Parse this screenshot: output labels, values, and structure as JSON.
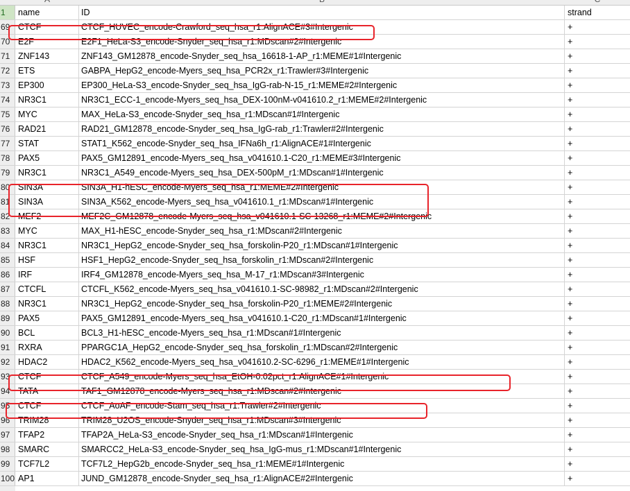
{
  "columns": {
    "row_header_label": "1",
    "letters": [
      "A",
      "B",
      "C"
    ],
    "headers": [
      "name",
      "ID",
      "strand"
    ]
  },
  "rows": [
    {
      "num": "69",
      "name": "CTCF",
      "id": "CTCF_HUVEC_encode-Crawford_seq_hsa_r1:AlignACE#3#Intergenic",
      "strand": "+"
    },
    {
      "num": "70",
      "name": "E2F",
      "id": "E2F1_HeLa-S3_encode-Snyder_seq_hsa_r1:MDscan#2#Intergenic",
      "strand": "+"
    },
    {
      "num": "71",
      "name": "ZNF143",
      "id": "ZNF143_GM12878_encode-Snyder_seq_hsa_16618-1-AP_r1:MEME#1#Intergenic",
      "strand": "+"
    },
    {
      "num": "72",
      "name": "ETS",
      "id": "GABPA_HepG2_encode-Myers_seq_hsa_PCR2x_r1:Trawler#3#Intergenic",
      "strand": "+"
    },
    {
      "num": "73",
      "name": "EP300",
      "id": "EP300_HeLa-S3_encode-Snyder_seq_hsa_IgG-rab-N-15_r1:MEME#2#Intergenic",
      "strand": "+"
    },
    {
      "num": "74",
      "name": "NR3C1",
      "id": "NR3C1_ECC-1_encode-Myers_seq_hsa_DEX-100nM-v041610.2_r1:MEME#2#Intergenic",
      "strand": "+"
    },
    {
      "num": "75",
      "name": "MYC",
      "id": "MAX_HeLa-S3_encode-Snyder_seq_hsa_r1:MDscan#1#Intergenic",
      "strand": "+"
    },
    {
      "num": "76",
      "name": "RAD21",
      "id": "RAD21_GM12878_encode-Snyder_seq_hsa_IgG-rab_r1:Trawler#2#Intergenic",
      "strand": "+"
    },
    {
      "num": "77",
      "name": "STAT",
      "id": "STAT1_K562_encode-Snyder_seq_hsa_IFNa6h_r1:AlignACE#1#Intergenic",
      "strand": "+"
    },
    {
      "num": "78",
      "name": "PAX5",
      "id": "PAX5_GM12891_encode-Myers_seq_hsa_v041610.1-C20_r1:MEME#3#Intergenic",
      "strand": "+"
    },
    {
      "num": "79",
      "name": "NR3C1",
      "id": "NR3C1_A549_encode-Myers_seq_hsa_DEX-500pM_r1:MDscan#1#Intergenic",
      "strand": "+"
    },
    {
      "num": "80",
      "name": "SIN3A",
      "id": "SIN3A_H1-hESC_encode-Myers_seq_hsa_r1:MEME#2#Intergenic",
      "strand": "+"
    },
    {
      "num": "81",
      "name": "SIN3A",
      "id": "SIN3A_K562_encode-Myers_seq_hsa_v041610.1_r1:MDscan#1#Intergenic",
      "strand": "+"
    },
    {
      "num": "82",
      "name": "MEF2",
      "id": "MEF2C_GM12878_encode-Myers_seq_hsa_v041610.1-SC-13268_r1:MEME#2#Intergenic",
      "strand": "+"
    },
    {
      "num": "83",
      "name": "MYC",
      "id": "MAX_H1-hESC_encode-Snyder_seq_hsa_r1:MDscan#2#Intergenic",
      "strand": "+"
    },
    {
      "num": "84",
      "name": "NR3C1",
      "id": "NR3C1_HepG2_encode-Snyder_seq_hsa_forskolin-P20_r1:MDscan#1#Intergenic",
      "strand": "+"
    },
    {
      "num": "85",
      "name": "HSF",
      "id": "HSF1_HepG2_encode-Snyder_seq_hsa_forskolin_r1:MDscan#2#Intergenic",
      "strand": "+"
    },
    {
      "num": "86",
      "name": "IRF",
      "id": "IRF4_GM12878_encode-Myers_seq_hsa_M-17_r1:MDscan#3#Intergenic",
      "strand": "+"
    },
    {
      "num": "87",
      "name": "CTCFL",
      "id": "CTCFL_K562_encode-Myers_seq_hsa_v041610.1-SC-98982_r1:MDscan#2#Intergenic",
      "strand": "+"
    },
    {
      "num": "88",
      "name": "NR3C1",
      "id": "NR3C1_HepG2_encode-Snyder_seq_hsa_forskolin-P20_r1:MEME#2#Intergenic",
      "strand": "+"
    },
    {
      "num": "89",
      "name": "PAX5",
      "id": "PAX5_GM12891_encode-Myers_seq_hsa_v041610.1-C20_r1:MDscan#1#Intergenic",
      "strand": "+"
    },
    {
      "num": "90",
      "name": "BCL",
      "id": "BCL3_H1-hESC_encode-Myers_seq_hsa_r1:MDscan#1#Intergenic",
      "strand": "+"
    },
    {
      "num": "91",
      "name": "RXRA",
      "id": "PPARGC1A_HepG2_encode-Snyder_seq_hsa_forskolin_r1:MDscan#2#Intergenic",
      "strand": "+"
    },
    {
      "num": "92",
      "name": "HDAC2",
      "id": "HDAC2_K562_encode-Myers_seq_hsa_v041610.2-SC-6296_r1:MEME#1#Intergenic",
      "strand": "+"
    },
    {
      "num": "93",
      "name": "CTCF",
      "id": "CTCF_A549_encode-Myers_seq_hsa_EtOH-0.02pct_r1:AlignACE#1#Intergenic",
      "strand": "+"
    },
    {
      "num": "94",
      "name": "TATA",
      "id": "TAF1_GM12878_encode-Myers_seq_hsa_r1:MDscan#2#Intergenic",
      "strand": "+"
    },
    {
      "num": "95",
      "name": "CTCF",
      "id": "CTCF_AoAF_encode-Stam_seq_hsa_r1:Trawler#2#Intergenic",
      "strand": "+"
    },
    {
      "num": "96",
      "name": "TRIM28",
      "id": "TRIM28_U2OS_encode-Snyder_seq_hsa_r1:MDscan#3#Intergenic",
      "strand": "+"
    },
    {
      "num": "97",
      "name": "TFAP2",
      "id": "TFAP2A_HeLa-S3_encode-Snyder_seq_hsa_r1:MDscan#1#Intergenic",
      "strand": "+"
    },
    {
      "num": "98",
      "name": "SMARC",
      "id": "SMARCC2_HeLa-S3_encode-Snyder_seq_hsa_IgG-mus_r1:MDscan#1#Intergenic",
      "strand": "+"
    },
    {
      "num": "99",
      "name": "TCF7L2",
      "id": "TCF7L2_HepG2b_encode-Snyder_seq_hsa_r1:MEME#1#Intergenic",
      "strand": "+"
    },
    {
      "num": "100",
      "name": "AP1",
      "id": "JUND_GM12878_encode-Snyder_seq_hsa_r1:AlignACE#2#Intergenic",
      "strand": "+"
    }
  ],
  "highlight_color": "#e8232a"
}
